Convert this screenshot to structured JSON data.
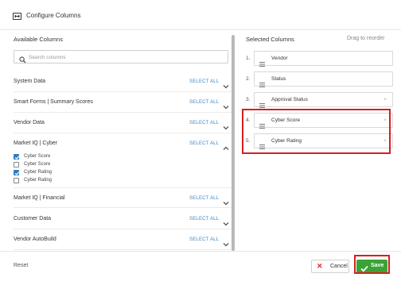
{
  "header": {
    "title": "Configure Columns",
    "icon": "column-layout-icon"
  },
  "available": {
    "heading": "Available Columns",
    "search_placeholder": "Search columns",
    "select_all_label": "SELECT ALL",
    "groups": [
      {
        "name": "System Data",
        "expanded": false
      },
      {
        "name": "Smart Forms | Summary Scores",
        "expanded": false
      },
      {
        "name": "Vendor Data",
        "expanded": false
      },
      {
        "name": "Market IQ | Cyber",
        "expanded": true
      },
      {
        "name": "Market IQ | Financial",
        "expanded": false
      },
      {
        "name": "Customer Data",
        "expanded": false
      },
      {
        "name": "Vendor AutoBuild",
        "expanded": false
      }
    ],
    "cyber_items": [
      {
        "label": "Cyber Score",
        "checked": true
      },
      {
        "label": "Cyber Score",
        "checked": false
      },
      {
        "label": "Cyber Rating",
        "checked": true
      },
      {
        "label": "Cyber Rating",
        "checked": false
      }
    ]
  },
  "selected": {
    "heading": "Selected Columns",
    "reorder_hint": "Drag to reorder",
    "items": [
      {
        "num": "1.",
        "label": "Vendor",
        "removable": false
      },
      {
        "num": "2.",
        "label": "Status",
        "removable": false
      },
      {
        "num": "3.",
        "label": "Approval Status",
        "removable": true
      },
      {
        "num": "4.",
        "label": "Cyber Score",
        "removable": true
      },
      {
        "num": "5.",
        "label": "Cyber Rating",
        "removable": true
      }
    ]
  },
  "footer": {
    "reset": "Reset",
    "cancel": "Cancel",
    "save": "Save"
  },
  "colors": {
    "accent": "#3a87c8",
    "save": "#3aa335",
    "highlight": "#d61f1f",
    "cancel_icon": "#d62a2a"
  }
}
